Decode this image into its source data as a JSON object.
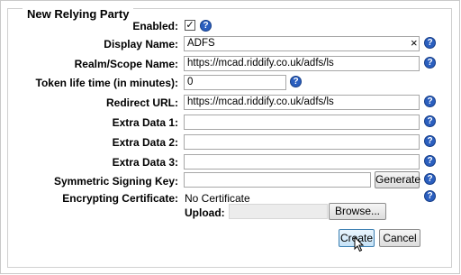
{
  "panel": {
    "title": "New Relying Party"
  },
  "fields": {
    "enabled_label": "Enabled:",
    "enabled_mark": "✓",
    "display_name_label": "Display Name:",
    "display_name_value": "ADFS",
    "display_name_clear": "×",
    "realm_label": "Realm/Scope Name:",
    "realm_value": "https://mcad.riddify.co.uk/adfs/ls",
    "token_label": "Token life time (in minutes):",
    "token_value": "0",
    "redirect_label": "Redirect URL:",
    "redirect_value": "https://mcad.riddify.co.uk/adfs/ls",
    "extra1_label": "Extra Data 1:",
    "extra2_label": "Extra Data 2:",
    "extra3_label": "Extra Data 3:",
    "signing_label": "Symmetric Signing Key:",
    "generate_label": "Generate",
    "cert_label": "Encrypting Certificate:",
    "cert_value": "No Certificate",
    "upload_label": "Upload:",
    "browse_label": "Browse..."
  },
  "help_glyph": "?",
  "actions": {
    "create": "Create",
    "cancel": "Cancel"
  },
  "icons": {
    "help": "help-icon",
    "cursor": "mouse-pointer-icon"
  },
  "colors": {
    "help": "#2b5fbf",
    "create_border": "#3c7fb1",
    "create_bg": "#d9ecfa"
  }
}
